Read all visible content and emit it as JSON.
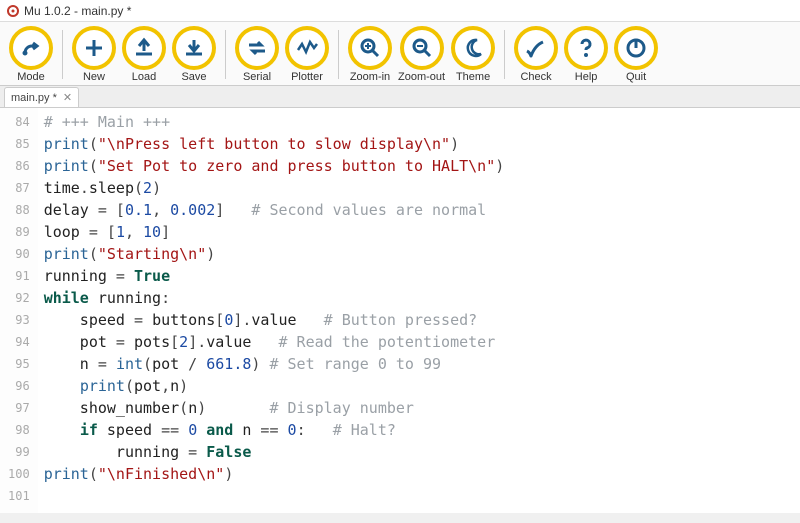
{
  "window": {
    "title": "Mu 1.0.2 - main.py *"
  },
  "toolbar": {
    "groups": [
      [
        "mode"
      ],
      [
        "new",
        "load",
        "save"
      ],
      [
        "serial",
        "plotter"
      ],
      [
        "zoomin",
        "zoomout",
        "theme"
      ],
      [
        "check",
        "help",
        "quit"
      ]
    ],
    "labels": {
      "mode": "Mode",
      "new": "New",
      "load": "Load",
      "save": "Save",
      "serial": "Serial",
      "plotter": "Plotter",
      "zoomin": "Zoom-in",
      "zoomout": "Zoom-out",
      "theme": "Theme",
      "check": "Check",
      "help": "Help",
      "quit": "Quit"
    }
  },
  "tab": {
    "label": "main.py *"
  },
  "code": {
    "first_line": 84,
    "lines": [
      [
        {
          "t": "comment",
          "v": "# +++ Main +++"
        }
      ],
      [
        {
          "t": "builtin",
          "v": "print"
        },
        {
          "t": "punc",
          "v": "("
        },
        {
          "t": "string",
          "v": "\"\\nPress left button to slow display\\n\""
        },
        {
          "t": "punc",
          "v": ")"
        }
      ],
      [
        {
          "t": "builtin",
          "v": "print"
        },
        {
          "t": "punc",
          "v": "("
        },
        {
          "t": "string",
          "v": "\"Set Pot to zero and press button to HALT\\n\""
        },
        {
          "t": "punc",
          "v": ")"
        }
      ],
      [
        {
          "t": "id",
          "v": "time"
        },
        {
          "t": "punc",
          "v": "."
        },
        {
          "t": "id",
          "v": "sleep"
        },
        {
          "t": "punc",
          "v": "("
        },
        {
          "t": "number",
          "v": "2"
        },
        {
          "t": "punc",
          "v": ")"
        }
      ],
      [
        {
          "t": "id",
          "v": "delay"
        },
        {
          "t": "punc",
          "v": " = ["
        },
        {
          "t": "number",
          "v": "0.1"
        },
        {
          "t": "punc",
          "v": ", "
        },
        {
          "t": "number",
          "v": "0.002"
        },
        {
          "t": "punc",
          "v": "]   "
        },
        {
          "t": "comment",
          "v": "# Second values are normal"
        }
      ],
      [
        {
          "t": "id",
          "v": "loop"
        },
        {
          "t": "punc",
          "v": " = ["
        },
        {
          "t": "number",
          "v": "1"
        },
        {
          "t": "punc",
          "v": ", "
        },
        {
          "t": "number",
          "v": "10"
        },
        {
          "t": "punc",
          "v": "]"
        }
      ],
      [
        {
          "t": "builtin",
          "v": "print"
        },
        {
          "t": "punc",
          "v": "("
        },
        {
          "t": "string",
          "v": "\"Starting\\n\""
        },
        {
          "t": "punc",
          "v": ")"
        }
      ],
      [
        {
          "t": "id",
          "v": "running"
        },
        {
          "t": "punc",
          "v": " = "
        },
        {
          "t": "bool",
          "v": "True"
        }
      ],
      [
        {
          "t": "kw",
          "v": "while"
        },
        {
          "t": "id",
          "v": " running"
        },
        {
          "t": "punc",
          "v": ":"
        }
      ],
      [
        {
          "t": "id",
          "v": "    speed"
        },
        {
          "t": "punc",
          "v": " = "
        },
        {
          "t": "id",
          "v": "buttons"
        },
        {
          "t": "punc",
          "v": "["
        },
        {
          "t": "number",
          "v": "0"
        },
        {
          "t": "punc",
          "v": "]."
        },
        {
          "t": "id",
          "v": "value"
        },
        {
          "t": "punc",
          "v": "   "
        },
        {
          "t": "comment",
          "v": "# Button pressed?"
        }
      ],
      [
        {
          "t": "id",
          "v": "    pot"
        },
        {
          "t": "punc",
          "v": " = "
        },
        {
          "t": "id",
          "v": "pots"
        },
        {
          "t": "punc",
          "v": "["
        },
        {
          "t": "number",
          "v": "2"
        },
        {
          "t": "punc",
          "v": "]."
        },
        {
          "t": "id",
          "v": "value"
        },
        {
          "t": "punc",
          "v": "   "
        },
        {
          "t": "comment",
          "v": "# Read the potentiometer"
        }
      ],
      [
        {
          "t": "id",
          "v": "    n"
        },
        {
          "t": "punc",
          "v": " = "
        },
        {
          "t": "builtin",
          "v": "int"
        },
        {
          "t": "punc",
          "v": "("
        },
        {
          "t": "id",
          "v": "pot"
        },
        {
          "t": "punc",
          "v": " / "
        },
        {
          "t": "number",
          "v": "661.8"
        },
        {
          "t": "punc",
          "v": ") "
        },
        {
          "t": "comment",
          "v": "# Set range 0 to 99"
        }
      ],
      [
        {
          "t": "id",
          "v": "    "
        },
        {
          "t": "builtin",
          "v": "print"
        },
        {
          "t": "punc",
          "v": "("
        },
        {
          "t": "id",
          "v": "pot"
        },
        {
          "t": "punc",
          "v": ","
        },
        {
          "t": "id",
          "v": "n"
        },
        {
          "t": "punc",
          "v": ")"
        }
      ],
      [
        {
          "t": "id",
          "v": "    show_number"
        },
        {
          "t": "punc",
          "v": "("
        },
        {
          "t": "id",
          "v": "n"
        },
        {
          "t": "punc",
          "v": ")       "
        },
        {
          "t": "comment",
          "v": "# Display number"
        }
      ],
      [
        {
          "t": "id",
          "v": "    "
        },
        {
          "t": "kw",
          "v": "if"
        },
        {
          "t": "id",
          "v": " speed"
        },
        {
          "t": "punc",
          "v": " == "
        },
        {
          "t": "number",
          "v": "0"
        },
        {
          "t": "punc",
          "v": " "
        },
        {
          "t": "kw",
          "v": "and"
        },
        {
          "t": "id",
          "v": " n"
        },
        {
          "t": "punc",
          "v": " == "
        },
        {
          "t": "number",
          "v": "0"
        },
        {
          "t": "punc",
          "v": ":   "
        },
        {
          "t": "comment",
          "v": "# Halt?"
        }
      ],
      [
        {
          "t": "id",
          "v": "        running"
        },
        {
          "t": "punc",
          "v": " = "
        },
        {
          "t": "bool",
          "v": "False"
        }
      ],
      [
        {
          "t": "builtin",
          "v": "print"
        },
        {
          "t": "punc",
          "v": "("
        },
        {
          "t": "string",
          "v": "\"\\nFinished\\n\""
        },
        {
          "t": "punc",
          "v": ")"
        }
      ],
      [
        {
          "t": "id",
          "v": ""
        }
      ]
    ]
  }
}
